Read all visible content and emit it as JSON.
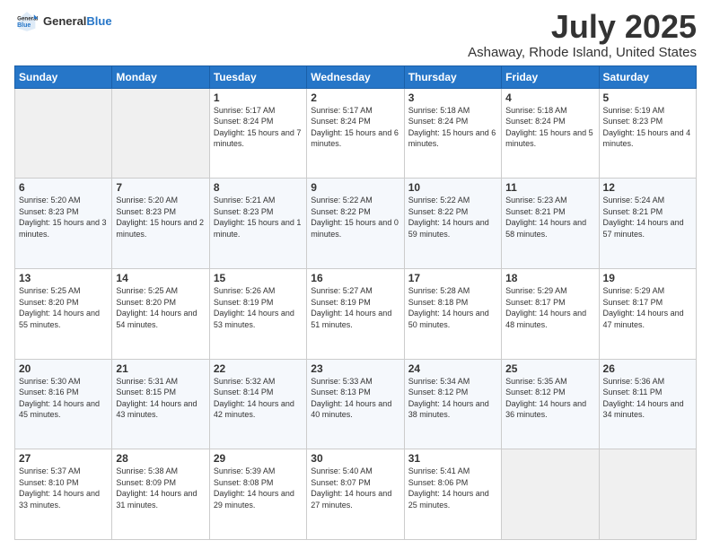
{
  "logo": {
    "general": "General",
    "blue": "Blue"
  },
  "title": "July 2025",
  "subtitle": "Ashaway, Rhode Island, United States",
  "days_of_week": [
    "Sunday",
    "Monday",
    "Tuesday",
    "Wednesday",
    "Thursday",
    "Friday",
    "Saturday"
  ],
  "weeks": [
    [
      {
        "day": "",
        "sunrise": "",
        "sunset": "",
        "daylight": ""
      },
      {
        "day": "",
        "sunrise": "",
        "sunset": "",
        "daylight": ""
      },
      {
        "day": "1",
        "sunrise": "Sunrise: 5:17 AM",
        "sunset": "Sunset: 8:24 PM",
        "daylight": "Daylight: 15 hours and 7 minutes."
      },
      {
        "day": "2",
        "sunrise": "Sunrise: 5:17 AM",
        "sunset": "Sunset: 8:24 PM",
        "daylight": "Daylight: 15 hours and 6 minutes."
      },
      {
        "day": "3",
        "sunrise": "Sunrise: 5:18 AM",
        "sunset": "Sunset: 8:24 PM",
        "daylight": "Daylight: 15 hours and 6 minutes."
      },
      {
        "day": "4",
        "sunrise": "Sunrise: 5:18 AM",
        "sunset": "Sunset: 8:24 PM",
        "daylight": "Daylight: 15 hours and 5 minutes."
      },
      {
        "day": "5",
        "sunrise": "Sunrise: 5:19 AM",
        "sunset": "Sunset: 8:23 PM",
        "daylight": "Daylight: 15 hours and 4 minutes."
      }
    ],
    [
      {
        "day": "6",
        "sunrise": "Sunrise: 5:20 AM",
        "sunset": "Sunset: 8:23 PM",
        "daylight": "Daylight: 15 hours and 3 minutes."
      },
      {
        "day": "7",
        "sunrise": "Sunrise: 5:20 AM",
        "sunset": "Sunset: 8:23 PM",
        "daylight": "Daylight: 15 hours and 2 minutes."
      },
      {
        "day": "8",
        "sunrise": "Sunrise: 5:21 AM",
        "sunset": "Sunset: 8:23 PM",
        "daylight": "Daylight: 15 hours and 1 minute."
      },
      {
        "day": "9",
        "sunrise": "Sunrise: 5:22 AM",
        "sunset": "Sunset: 8:22 PM",
        "daylight": "Daylight: 15 hours and 0 minutes."
      },
      {
        "day": "10",
        "sunrise": "Sunrise: 5:22 AM",
        "sunset": "Sunset: 8:22 PM",
        "daylight": "Daylight: 14 hours and 59 minutes."
      },
      {
        "day": "11",
        "sunrise": "Sunrise: 5:23 AM",
        "sunset": "Sunset: 8:21 PM",
        "daylight": "Daylight: 14 hours and 58 minutes."
      },
      {
        "day": "12",
        "sunrise": "Sunrise: 5:24 AM",
        "sunset": "Sunset: 8:21 PM",
        "daylight": "Daylight: 14 hours and 57 minutes."
      }
    ],
    [
      {
        "day": "13",
        "sunrise": "Sunrise: 5:25 AM",
        "sunset": "Sunset: 8:20 PM",
        "daylight": "Daylight: 14 hours and 55 minutes."
      },
      {
        "day": "14",
        "sunrise": "Sunrise: 5:25 AM",
        "sunset": "Sunset: 8:20 PM",
        "daylight": "Daylight: 14 hours and 54 minutes."
      },
      {
        "day": "15",
        "sunrise": "Sunrise: 5:26 AM",
        "sunset": "Sunset: 8:19 PM",
        "daylight": "Daylight: 14 hours and 53 minutes."
      },
      {
        "day": "16",
        "sunrise": "Sunrise: 5:27 AM",
        "sunset": "Sunset: 8:19 PM",
        "daylight": "Daylight: 14 hours and 51 minutes."
      },
      {
        "day": "17",
        "sunrise": "Sunrise: 5:28 AM",
        "sunset": "Sunset: 8:18 PM",
        "daylight": "Daylight: 14 hours and 50 minutes."
      },
      {
        "day": "18",
        "sunrise": "Sunrise: 5:29 AM",
        "sunset": "Sunset: 8:17 PM",
        "daylight": "Daylight: 14 hours and 48 minutes."
      },
      {
        "day": "19",
        "sunrise": "Sunrise: 5:29 AM",
        "sunset": "Sunset: 8:17 PM",
        "daylight": "Daylight: 14 hours and 47 minutes."
      }
    ],
    [
      {
        "day": "20",
        "sunrise": "Sunrise: 5:30 AM",
        "sunset": "Sunset: 8:16 PM",
        "daylight": "Daylight: 14 hours and 45 minutes."
      },
      {
        "day": "21",
        "sunrise": "Sunrise: 5:31 AM",
        "sunset": "Sunset: 8:15 PM",
        "daylight": "Daylight: 14 hours and 43 minutes."
      },
      {
        "day": "22",
        "sunrise": "Sunrise: 5:32 AM",
        "sunset": "Sunset: 8:14 PM",
        "daylight": "Daylight: 14 hours and 42 minutes."
      },
      {
        "day": "23",
        "sunrise": "Sunrise: 5:33 AM",
        "sunset": "Sunset: 8:13 PM",
        "daylight": "Daylight: 14 hours and 40 minutes."
      },
      {
        "day": "24",
        "sunrise": "Sunrise: 5:34 AM",
        "sunset": "Sunset: 8:12 PM",
        "daylight": "Daylight: 14 hours and 38 minutes."
      },
      {
        "day": "25",
        "sunrise": "Sunrise: 5:35 AM",
        "sunset": "Sunset: 8:12 PM",
        "daylight": "Daylight: 14 hours and 36 minutes."
      },
      {
        "day": "26",
        "sunrise": "Sunrise: 5:36 AM",
        "sunset": "Sunset: 8:11 PM",
        "daylight": "Daylight: 14 hours and 34 minutes."
      }
    ],
    [
      {
        "day": "27",
        "sunrise": "Sunrise: 5:37 AM",
        "sunset": "Sunset: 8:10 PM",
        "daylight": "Daylight: 14 hours and 33 minutes."
      },
      {
        "day": "28",
        "sunrise": "Sunrise: 5:38 AM",
        "sunset": "Sunset: 8:09 PM",
        "daylight": "Daylight: 14 hours and 31 minutes."
      },
      {
        "day": "29",
        "sunrise": "Sunrise: 5:39 AM",
        "sunset": "Sunset: 8:08 PM",
        "daylight": "Daylight: 14 hours and 29 minutes."
      },
      {
        "day": "30",
        "sunrise": "Sunrise: 5:40 AM",
        "sunset": "Sunset: 8:07 PM",
        "daylight": "Daylight: 14 hours and 27 minutes."
      },
      {
        "day": "31",
        "sunrise": "Sunrise: 5:41 AM",
        "sunset": "Sunset: 8:06 PM",
        "daylight": "Daylight: 14 hours and 25 minutes."
      },
      {
        "day": "",
        "sunrise": "",
        "sunset": "",
        "daylight": ""
      },
      {
        "day": "",
        "sunrise": "",
        "sunset": "",
        "daylight": ""
      }
    ]
  ]
}
